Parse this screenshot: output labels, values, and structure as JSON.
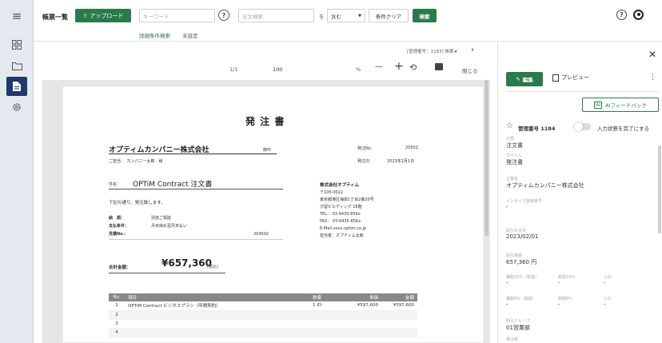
{
  "nav": {
    "menu_icon": "≡",
    "items": [
      {
        "name": "dashboard-icon"
      },
      {
        "name": "folder-icon"
      },
      {
        "name": "document-icon",
        "active": true
      },
      {
        "name": "settings-icon"
      }
    ]
  },
  "topbar": {
    "title": "帳票一覧",
    "upload_label": "アップロード",
    "keyword_placeholder": "キーワード",
    "fulltext_placeholder": "全文検索",
    "wo": "を",
    "contains": "含む",
    "clear_label": "条件クリア",
    "search_label": "検索",
    "detail_search": "詳細条件検索",
    "not_set": "未設定"
  },
  "viewer": {
    "nav_text": "[管理番号：1183] 帳票★",
    "page": "1/1",
    "zoom": "100",
    "zoom_unit": "%",
    "minus": "—",
    "plus": "+",
    "close": "閉じる"
  },
  "doc": {
    "heading": "発 注 書",
    "company": "オプティムカンパニー株式会社",
    "onchu": "御中",
    "tanto": "ご担当：　カンパニー太郎　様",
    "order_no_label": "発注No.",
    "order_no": "20502",
    "order_date_label": "発注日：",
    "order_date": "2023年2月1日",
    "subject_label": "件名：",
    "subject": "OPTiM Contract 注文書",
    "order_line": "下記の通り、発注致します。",
    "delivery_label": "納　期：",
    "delivery": "別途ご相談",
    "payment_label": "支払条件：",
    "payment": "月末締め翌月末払い",
    "estimate_label": "見積No.：",
    "estimate": "204502",
    "total_label": "合計金額：",
    "total": "¥657,360",
    "total_tax": "(税込)",
    "issuer": "株式会社オプティム",
    "issuer_lines": [
      "〒105-0022",
      "東京都港区海岸1丁目2番20号",
      "汐留ビルディング 18階",
      "TEL： 03-6435-856x",
      "FAX： 03-6435-856x",
      "E-Mail  xxxx.optim.co.jp",
      "担当者：オプティム太郎"
    ],
    "table": {
      "headers": [
        "No.",
        "項目",
        "数量",
        "単価",
        "金額"
      ],
      "rows": [
        [
          "1",
          "OPTiM Contract ビジネスプラン（年間契約）",
          "1 ID",
          "¥597,600",
          "¥597,600"
        ],
        [
          "2",
          "",
          "",
          "",
          ""
        ],
        [
          "3",
          "",
          "",
          "",
          ""
        ],
        [
          "4",
          "",
          "",
          "",
          ""
        ]
      ]
    }
  },
  "panel": {
    "edit_label": "編集",
    "preview_label": "プレビュー",
    "ai_label": "AIフィードバック",
    "mgmt_label": "管理番号 1184",
    "complete_label": "入力状態を完了にする",
    "fields": [
      {
        "label": "分類",
        "value": "注文書"
      },
      {
        "label": "タイトル",
        "value": "発注書"
      },
      {
        "label": "企業名",
        "value": "オプティムカンパニー株式会社"
      },
      {
        "label": "インボイス登録番号",
        "value": "-"
      },
      {
        "label": "取引年月日",
        "value": "2023/02/01"
      },
      {
        "label": "取引金額",
        "value": "657,360 円"
      }
    ],
    "tax_row1": [
      {
        "label": "課税10%（税抜）",
        "value": "-"
      },
      {
        "label": "税額10%",
        "value": "-"
      },
      {
        "label": "小計",
        "value": "-"
      }
    ],
    "tax_row2": [
      {
        "label": "課税8%（税抜）",
        "value": "-"
      },
      {
        "label": "税額8%",
        "value": "-"
      },
      {
        "label": "小計",
        "value": "-"
      }
    ],
    "group_label": "取引グループ",
    "group_value": "01営業部",
    "next_label": "発注者"
  }
}
